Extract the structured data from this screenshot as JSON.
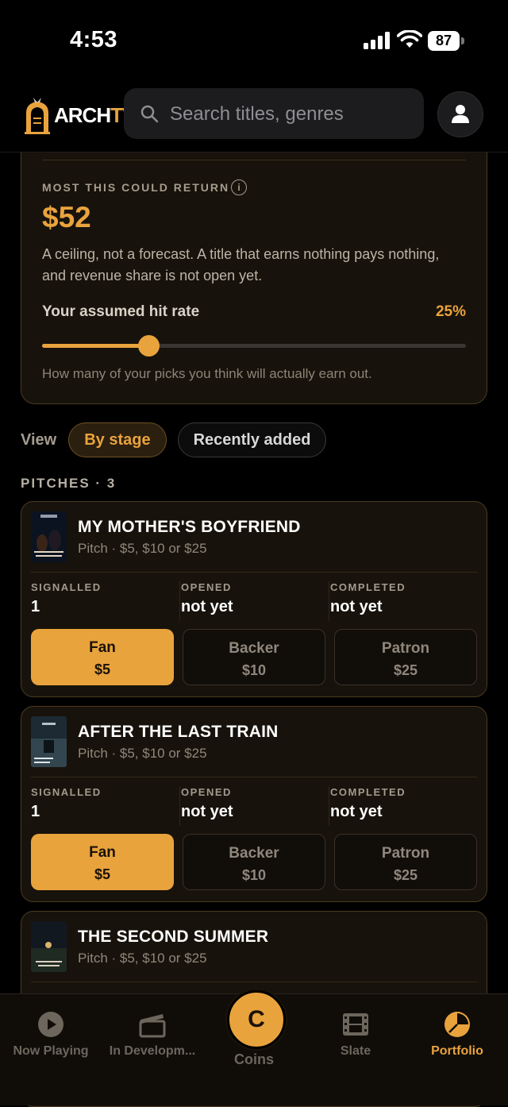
{
  "status": {
    "time": "4:53",
    "battery": "87"
  },
  "header": {
    "brand_arch": "ARCH",
    "brand_tv": "TV",
    "search_placeholder": "Search titles, genres"
  },
  "return_card": {
    "overline": "MOST THIS COULD RETURN",
    "amount": "$52",
    "description": "A ceiling, not a forecast. A title that earns nothing pays nothing, and revenue share is not open yet.",
    "hit_rate_label": "Your assumed hit rate",
    "hit_rate_value": "25%",
    "hit_rate_fraction": 0.25,
    "hint": "How many of your picks you think will actually earn out."
  },
  "view": {
    "label": "View",
    "options": [
      "By stage",
      "Recently added"
    ],
    "selected": "By stage"
  },
  "section_title": "PITCHES · 3",
  "pitches": [
    {
      "title": "MY MOTHER'S BOYFRIEND",
      "subtitle": "Pitch · $5, $10 or $25",
      "stats": [
        {
          "label": "SIGNALLED",
          "value": "1"
        },
        {
          "label": "OPENED",
          "value": "not yet"
        },
        {
          "label": "COMPLETED",
          "value": "not yet"
        }
      ],
      "tiers": [
        {
          "name": "Fan",
          "price": "$5",
          "selected": true
        },
        {
          "name": "Backer",
          "price": "$10",
          "selected": false
        },
        {
          "name": "Patron",
          "price": "$25",
          "selected": false
        }
      ]
    },
    {
      "title": "AFTER THE LAST TRAIN",
      "subtitle": "Pitch · $5, $10 or $25",
      "stats": [
        {
          "label": "SIGNALLED",
          "value": "1"
        },
        {
          "label": "OPENED",
          "value": "not yet"
        },
        {
          "label": "COMPLETED",
          "value": "not yet"
        }
      ],
      "tiers": [
        {
          "name": "Fan",
          "price": "$5",
          "selected": true
        },
        {
          "name": "Backer",
          "price": "$10",
          "selected": false
        },
        {
          "name": "Patron",
          "price": "$25",
          "selected": false
        }
      ]
    },
    {
      "title": "THE SECOND SUMMER",
      "subtitle": "Pitch · $5, $10 or $25"
    }
  ],
  "tabs": [
    {
      "label": "Now Playing",
      "icon": "play-circle-icon"
    },
    {
      "label": "In Developm...",
      "icon": "clapperboard-icon"
    },
    {
      "label": "Coins",
      "icon": "coin-icon",
      "glyph": "C"
    },
    {
      "label": "Slate",
      "icon": "film-strip-icon"
    },
    {
      "label": "Portfolio",
      "icon": "pie-chart-icon",
      "active": true
    }
  ],
  "colors": {
    "accent": "#e9a33d",
    "card_bg": "#17120b",
    "card_border": "#4a3a22"
  }
}
